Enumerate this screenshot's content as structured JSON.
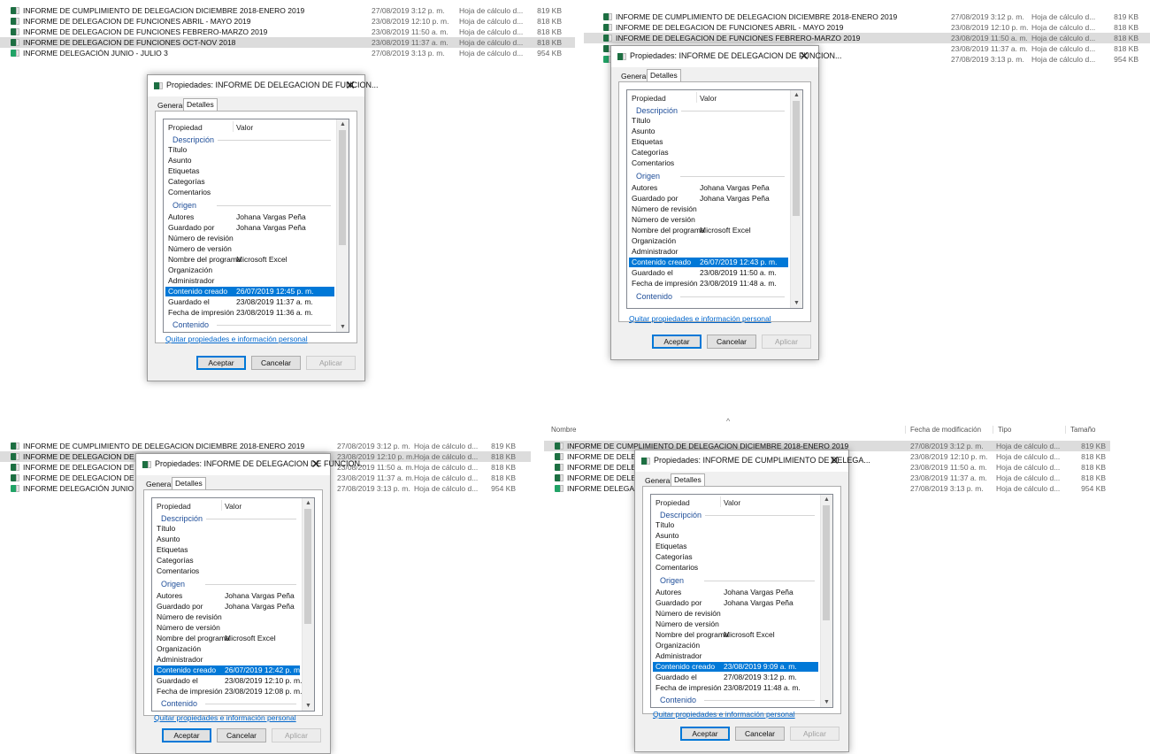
{
  "screens": [
    {
      "files": [
        {
          "name": "INFORME DE CUMPLIMIENTO DE DELEGACION DICIEMBRE 2018-ENERO 2019",
          "date": "27/08/2019 3:12 p. m.",
          "type": "Hoja de cálculo d...",
          "size": "819 KB",
          "selected": false
        },
        {
          "name": "INFORME DE DELEGACION DE FUNCIONES ABRIL - MAYO 2019",
          "date": "23/08/2019 12:10 p. m.",
          "type": "Hoja de cálculo d...",
          "size": "818 KB",
          "selected": false
        },
        {
          "name": "INFORME DE DELEGACION DE FUNCIONES FEBRERO-MARZO 2019",
          "date": "23/08/2019 11:50 a. m.",
          "type": "Hoja de cálculo d...",
          "size": "818 KB",
          "selected": false
        },
        {
          "name": "INFORME DE DELEGACION DE FUNCIONES OCT-NOV 2018",
          "date": "23/08/2019 11:37 a. m.",
          "type": "Hoja de cálculo d...",
          "size": "818 KB",
          "selected": true
        },
        {
          "name": "INFORME DELEGACIÓN JUNIO - JULIO 3",
          "date": "27/08/2019 3:13 p. m.",
          "type": "Hoja de cálculo d...",
          "size": "954 KB",
          "selected": false
        }
      ],
      "dialog": {
        "title": "Propiedades: INFORME DE DELEGACION DE FUNCION...",
        "tabs": [
          "General",
          "Detalles"
        ],
        "col_property": "Propiedad",
        "col_value": "Valor",
        "sections": {
          "description": "Descripción",
          "origin": "Origen",
          "content": "Contenido"
        },
        "rows": [
          {
            "label": "Título",
            "value": ""
          },
          {
            "label": "Asunto",
            "value": ""
          },
          {
            "label": "Etiquetas",
            "value": ""
          },
          {
            "label": "Categorías",
            "value": ""
          },
          {
            "label": "Comentarios",
            "value": ""
          },
          {
            "label": "Autores",
            "value": "Johana Vargas Peña"
          },
          {
            "label": "Guardado por",
            "value": "Johana Vargas Peña"
          },
          {
            "label": "Número de revisión",
            "value": ""
          },
          {
            "label": "Número de versión",
            "value": ""
          },
          {
            "label": "Nombre del programa",
            "value": "Microsoft Excel"
          },
          {
            "label": "Organización",
            "value": ""
          },
          {
            "label": "Administrador",
            "value": ""
          },
          {
            "label": "Contenido creado",
            "value": "26/07/2019 12:45 p. m."
          },
          {
            "label": "Guardado el",
            "value": "23/08/2019 11:37 a. m."
          },
          {
            "label": "Fecha de impresión",
            "value": "23/08/2019 11:36 a. m."
          }
        ],
        "link": "Quitar propiedades e información personal",
        "buttons": {
          "ok": "Aceptar",
          "cancel": "Cancelar",
          "apply": "Aplicar"
        }
      }
    },
    {
      "files": [
        {
          "name": "INFORME DE CUMPLIMIENTO DE DELEGACION DICIEMBRE 2018-ENERO 2019",
          "date": "27/08/2019 3:12 p. m.",
          "type": "Hoja de cálculo d...",
          "size": "819 KB",
          "selected": false
        },
        {
          "name": "INFORME DE DELEGACION DE FUNCIONES ABRIL - MAYO 2019",
          "date": "23/08/2019 12:10 p. m.",
          "type": "Hoja de cálculo d...",
          "size": "818 KB",
          "selected": false
        },
        {
          "name": "INFORME DE DELEGACION DE FUNCIONES FEBRERO-MARZO 2019",
          "date": "23/08/2019 11:50 a. m.",
          "type": "Hoja de cálculo d...",
          "size": "818 KB",
          "selected": true
        },
        {
          "name": "",
          "date": "23/08/2019 11:37 a. m.",
          "type": "Hoja de cálculo d...",
          "size": "818 KB",
          "selected": false
        },
        {
          "name": "",
          "date": "27/08/2019 3:13 p. m.",
          "type": "Hoja de cálculo d...",
          "size": "954 KB",
          "selected": false
        }
      ],
      "dialog": {
        "title": "Propiedades: INFORME DE DELEGACION DE FUNCION...",
        "tabs": [
          "General",
          "Detalles"
        ],
        "col_property": "Propiedad",
        "col_value": "Valor",
        "sections": {
          "description": "Descripción",
          "origin": "Origen",
          "content": "Contenido"
        },
        "rows": [
          {
            "label": "Título",
            "value": ""
          },
          {
            "label": "Asunto",
            "value": ""
          },
          {
            "label": "Etiquetas",
            "value": ""
          },
          {
            "label": "Categorías",
            "value": ""
          },
          {
            "label": "Comentarios",
            "value": ""
          },
          {
            "label": "Autores",
            "value": "Johana Vargas Peña"
          },
          {
            "label": "Guardado por",
            "value": "Johana Vargas Peña"
          },
          {
            "label": "Número de revisión",
            "value": ""
          },
          {
            "label": "Número de versión",
            "value": ""
          },
          {
            "label": "Nombre del programa",
            "value": "Microsoft Excel"
          },
          {
            "label": "Organización",
            "value": ""
          },
          {
            "label": "Administrador",
            "value": ""
          },
          {
            "label": "Contenido creado",
            "value": "26/07/2019 12:43 p. m."
          },
          {
            "label": "Guardado el",
            "value": "23/08/2019 11:50 a. m."
          },
          {
            "label": "Fecha de impresión",
            "value": "23/08/2019 11:48 a. m."
          }
        ],
        "link": "Quitar propiedades e información personal",
        "buttons": {
          "ok": "Aceptar",
          "cancel": "Cancelar",
          "apply": "Aplicar"
        }
      }
    },
    {
      "files": [
        {
          "name": "INFORME DE CUMPLIMIENTO DE DELEGACION DICIEMBRE 2018-ENERO 2019",
          "date": "27/08/2019 3:12 p. m.",
          "type": "Hoja de cálculo d...",
          "size": "819 KB",
          "selected": false
        },
        {
          "name": "INFORME DE DELEGACION DE FUNCIO",
          "date": "23/08/2019 12:10 p. m.",
          "type": "Hoja de cálculo d...",
          "size": "818 KB",
          "selected": true
        },
        {
          "name": "INFORME DE DELEGACION DE FUNCIO",
          "date": "23/08/2019 11:50 a. m.",
          "type": "Hoja de cálculo d...",
          "size": "818 KB",
          "selected": false
        },
        {
          "name": "INFORME DE DELEGACION DE FUNCIO",
          "date": "23/08/2019 11:37 a. m.",
          "type": "Hoja de cálculo d...",
          "size": "818 KB",
          "selected": false
        },
        {
          "name": "INFORME DELEGACIÓN JUNIO - JULIO",
          "date": "27/08/2019 3:13 p. m.",
          "type": "Hoja de cálculo d...",
          "size": "954 KB",
          "selected": false
        }
      ],
      "dialog": {
        "title": "Propiedades: INFORME DE DELEGACION DE FUNCION...",
        "tabs": [
          "General",
          "Detalles"
        ],
        "col_property": "Propiedad",
        "col_value": "Valor",
        "sections": {
          "description": "Descripción",
          "origin": "Origen",
          "content": "Contenido"
        },
        "rows": [
          {
            "label": "Título",
            "value": ""
          },
          {
            "label": "Asunto",
            "value": ""
          },
          {
            "label": "Etiquetas",
            "value": ""
          },
          {
            "label": "Categorías",
            "value": ""
          },
          {
            "label": "Comentarios",
            "value": ""
          },
          {
            "label": "Autores",
            "value": "Johana Vargas Peña"
          },
          {
            "label": "Guardado por",
            "value": "Johana Vargas Peña"
          },
          {
            "label": "Número de revisión",
            "value": ""
          },
          {
            "label": "Número de versión",
            "value": ""
          },
          {
            "label": "Nombre del programa",
            "value": "Microsoft Excel"
          },
          {
            "label": "Organización",
            "value": ""
          },
          {
            "label": "Administrador",
            "value": ""
          },
          {
            "label": "Contenido creado",
            "value": "26/07/2019 12:42 p. m."
          },
          {
            "label": "Guardado el",
            "value": "23/08/2019 12:10 p. m."
          },
          {
            "label": "Fecha de impresión",
            "value": "23/08/2019 12:08 p. m."
          }
        ],
        "link": "Quitar propiedades e información personal",
        "buttons": {
          "ok": "Aceptar",
          "cancel": "Cancelar",
          "apply": "Aplicar"
        }
      }
    },
    {
      "header": {
        "name": "Nombre",
        "date": "Fecha de modificación",
        "type": "Tipo",
        "size": "Tamaño"
      },
      "files": [
        {
          "name": "INFORME DE CUMPLIMIENTO DE DELEGACION DICIEMBRE 2018-ENERO 2019",
          "date": "27/08/2019 3:12 p. m.",
          "type": "Hoja de cálculo d...",
          "size": "819 KB",
          "selected": true
        },
        {
          "name": "INFORME DE DELEGA",
          "date": "23/08/2019 12:10 p. m.",
          "type": "Hoja de cálculo d...",
          "size": "818 KB",
          "selected": false
        },
        {
          "name": "INFORME DE DELEGA",
          "date": "23/08/2019 11:50 a. m.",
          "type": "Hoja de cálculo d...",
          "size": "818 KB",
          "selected": false
        },
        {
          "name": "INFORME DE DELEGA",
          "date": "23/08/2019 11:37 a. m.",
          "type": "Hoja de cálculo d...",
          "size": "818 KB",
          "selected": false
        },
        {
          "name": "INFORME DELEGACIÓ",
          "date": "27/08/2019 3:13 p. m.",
          "type": "Hoja de cálculo d...",
          "size": "954 KB",
          "selected": false
        }
      ],
      "dialog": {
        "title": "Propiedades: INFORME DE CUMPLIMIENTO DE DELEGA...",
        "tabs": [
          "General",
          "Detalles"
        ],
        "col_property": "Propiedad",
        "col_value": "Valor",
        "sections": {
          "description": "Descripción",
          "origin": "Origen",
          "content": "Contenido"
        },
        "rows": [
          {
            "label": "Título",
            "value": ""
          },
          {
            "label": "Asunto",
            "value": ""
          },
          {
            "label": "Etiquetas",
            "value": ""
          },
          {
            "label": "Categorías",
            "value": ""
          },
          {
            "label": "Comentarios",
            "value": ""
          },
          {
            "label": "Autores",
            "value": "Johana Vargas Peña"
          },
          {
            "label": "Guardado por",
            "value": "Johana Vargas Peña"
          },
          {
            "label": "Número de revisión",
            "value": ""
          },
          {
            "label": "Número de versión",
            "value": ""
          },
          {
            "label": "Nombre del programa",
            "value": "Microsoft Excel"
          },
          {
            "label": "Organización",
            "value": ""
          },
          {
            "label": "Administrador",
            "value": ""
          },
          {
            "label": "Contenido creado",
            "value": "23/08/2019 9:09 a. m."
          },
          {
            "label": "Guardado el",
            "value": "27/08/2019 3:12 p. m."
          },
          {
            "label": "Fecha de impresión",
            "value": "23/08/2019 11:48 a. m."
          }
        ],
        "link": "Quitar propiedades e información personal",
        "buttons": {
          "ok": "Aceptar",
          "cancel": "Cancelar",
          "apply": "Aplicar"
        }
      }
    }
  ]
}
